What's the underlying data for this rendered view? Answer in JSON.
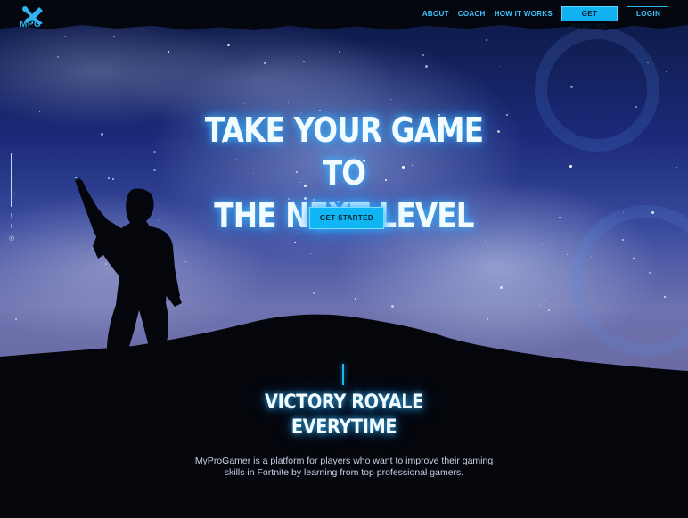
{
  "brand": {
    "logo_text": "MPG"
  },
  "nav": {
    "links": [
      "ABOUT",
      "COACH",
      "HOW IT WORKS"
    ],
    "cta_label": "GET STARTED",
    "login_label": "LOGIN"
  },
  "hero": {
    "title_line1": "TAKE YOUR GAME TO",
    "title_line2": "THE NEXT LEVEL",
    "cta_label": "GET STARTED"
  },
  "social": {
    "icons": [
      "facebook-icon",
      "twitter-icon",
      "instagram-icon"
    ],
    "glyphs": [
      "f",
      "t",
      "◎"
    ]
  },
  "intro": {
    "title_line1": "VICTORY ROYALE",
    "title_line2": "EVERYTIME",
    "body_line1": "MyProGamer is a platform for players who want to improve their gaming",
    "body_line2": "skills in Fortnite by learning from top professional gamers."
  },
  "colors": {
    "accent": "#12b2f0",
    "background": "#05070e",
    "glow": "#3fc6ff"
  }
}
